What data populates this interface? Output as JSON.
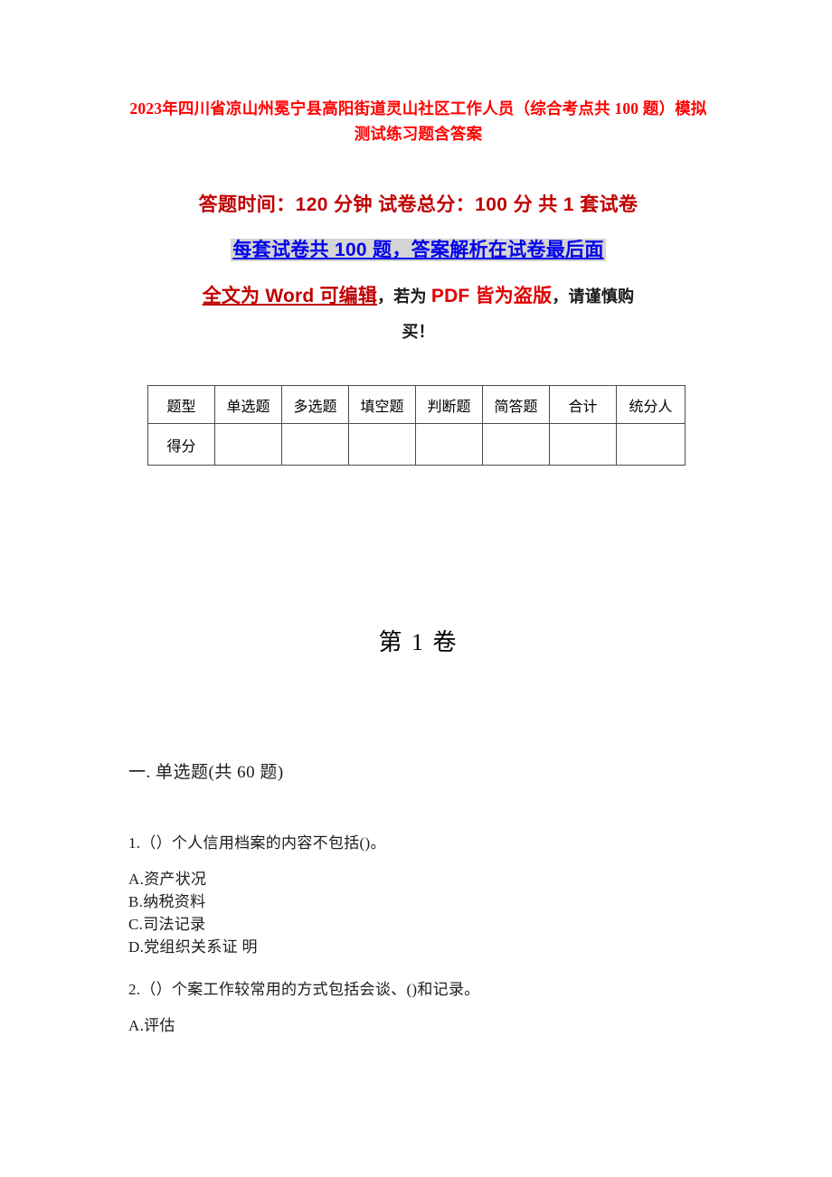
{
  "document": {
    "title": "2023年四川省凉山州冕宁县高阳街道灵山社区工作人员（综合考点共 100 题）模拟测试练习题含答案",
    "exam_info": "答题时间：120 分钟    试卷总分：100 分    共 1 套试卷",
    "highlight_note": "每套试卷共 100 题，答案解析在试卷最后面",
    "notice": {
      "word_part": "全文为 Word 可编辑",
      "plain_part": "，若为 ",
      "pdf_part": "PDF 皆为盗版",
      "tail_part": "，请谨慎购",
      "tail_line2": "买！"
    },
    "volume_title": "第 1 卷"
  },
  "score_table": {
    "headers": [
      "题型",
      "单选题",
      "多选题",
      "填空题",
      "判断题",
      "简答题",
      "合计",
      "统分人"
    ],
    "rows": [
      {
        "label": "得分",
        "cells": [
          "",
          "",
          "",
          "",
          "",
          "",
          ""
        ]
      }
    ]
  },
  "section": {
    "heading": "一. 单选题(共 60 题)"
  },
  "questions": [
    {
      "stem": "1.（）个人信用档案的内容不包括()。",
      "options": [
        "A.资产状况",
        "B.纳税资料",
        "C.司法记录",
        "D.党组织关系证  明"
      ]
    },
    {
      "stem": "2.（）个案工作较常用的方式包括会谈、()和记录。",
      "options": [
        "A.评估"
      ]
    }
  ],
  "colors": {
    "title_red": "#FF0000",
    "info_red": "#C00000",
    "highlight_blue": "#0000EE",
    "highlight_bg": "#D4D4D4",
    "pdf_red": "#E00000",
    "body_black": "#1c1c1c"
  }
}
